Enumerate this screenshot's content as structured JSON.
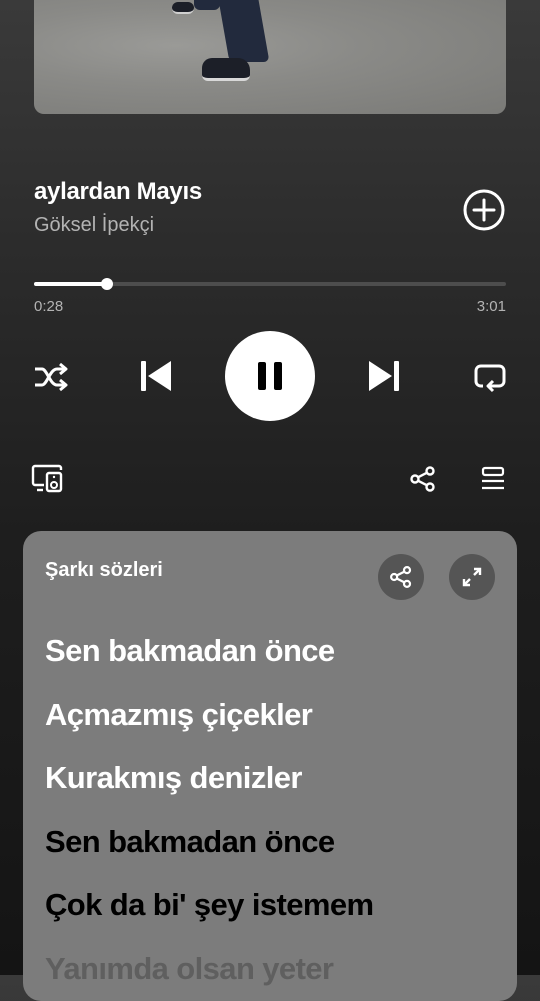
{
  "player": {
    "track_title": "aylardan Mayıs",
    "artist": "Göksel İpekçi",
    "elapsed": "0:28",
    "total": "3:01",
    "progress_fraction": 0.155
  },
  "icons": {
    "add": "plus-circle-icon",
    "shuffle": "shuffle-icon",
    "previous": "skip-previous-icon",
    "pause": "pause-icon",
    "next": "skip-next-icon",
    "repeat": "repeat-icon",
    "devices": "connect-device-icon",
    "share": "share-icon",
    "queue": "queue-icon",
    "expand": "expand-icon"
  },
  "lyrics": {
    "heading": "Şarkı sözleri",
    "lines": [
      "Sen bakmadan önce",
      "Açmazmış çiçekler",
      "Kurakmış denizler",
      "Sen bakmadan önce",
      "Çok da bi' şey istemem",
      "Yanımda olsan yeter"
    ]
  },
  "colors": {
    "accent": "#ffffff",
    "card": "#7c7c7c",
    "secondary_text": "#b3b3b3"
  }
}
